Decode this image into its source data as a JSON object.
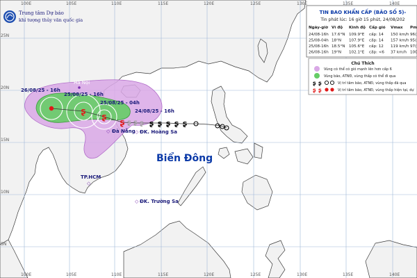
{
  "agency": {
    "name": "Trung tâm Dự báo",
    "subtitle": "khí tượng thủy văn quốc gia"
  },
  "grid_labels": {
    "lon_top": [
      "100E",
      "105E",
      "110E",
      "115E",
      "120E",
      "125E",
      "130E",
      "135E",
      "140E"
    ],
    "lon_bottom": [
      "100E",
      "105E",
      "110E",
      "115E",
      "120E",
      "125E",
      "130E",
      "135E",
      "140E"
    ],
    "lat_left": [
      "25N",
      "20N",
      "15N",
      "10N",
      "5N"
    ]
  },
  "places": {
    "sea": "Biển Đông",
    "hanoi": "Hà Nội",
    "danang": "Đà Nẵng",
    "hoangsa": "ĐK. Hoàng Sa",
    "tphcm": "TP.HCM",
    "truongsa": "ĐK. Trường Sa"
  },
  "track_labels": {
    "t1": "26/08/25 - 16h",
    "t2": "25/08/25 - 16h",
    "t3": "25/08/25 - 04h",
    "t4": "24/08/25 - 16h"
  },
  "bulletin": {
    "title": "TIN BAO KHẨN CẤP (BÃO SỐ 5)-",
    "issued": "Tin phát lúc: 16 giờ 15 phút, 24/08/202",
    "headers": [
      "Ngày-giờ",
      "Vĩ độ",
      "Kinh độ",
      "Cấp gió",
      "Vmax",
      "Pm"
    ],
    "rows": [
      [
        "24/08-16h",
        "17.6°N",
        "109.9°E",
        "cấp: 14",
        "150 km/h",
        "96("
      ],
      [
        "25/08-04h",
        "18°N",
        "107.9°E",
        "cấp: 14",
        "157 km/h",
        "95("
      ],
      [
        "25/08-16h",
        "18.5°N",
        "105.6°E",
        "cấp: 12",
        "119 km/h",
        "97("
      ],
      [
        "26/08-16h",
        "19°N",
        "102.1°E",
        "cấp: <6",
        "37 km/h",
        "100"
      ]
    ]
  },
  "legend": {
    "title": "Chú Thích",
    "items": [
      "Vùng có thể có gió mạnh lên hơn cấp 6",
      "Vùng bão, ATNĐ, vùng thấp có thể đi qua",
      "Vị trí tâm bão, ATNĐ, vùng thấp đã qua",
      "Vị trí tâm bão, ATNĐ, vùng thấp hiện tại, dự"
    ]
  },
  "colors": {
    "sea": "#ffffff",
    "land": "#f2f2f2",
    "grid": "#9fb8d8",
    "risk_zone": "#d9a8e6",
    "storm_zone": "#66cc66",
    "forecast_symbol": "#e01818",
    "past_symbol": "#000000",
    "track_line": "#333333",
    "panel_title": "#0b3aa8"
  }
}
